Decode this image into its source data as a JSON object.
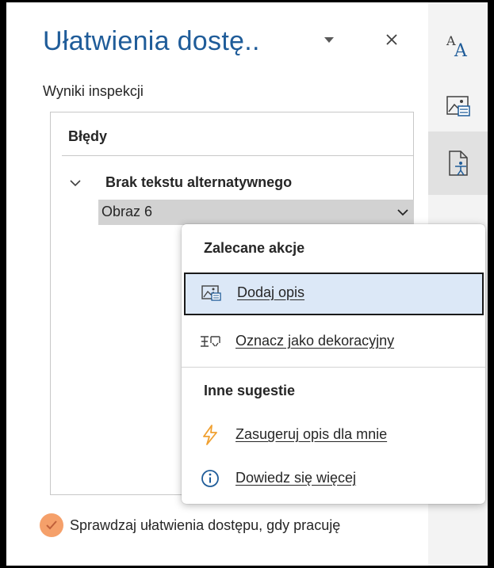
{
  "pane": {
    "title": "Ułatwienia dostę..",
    "results_label": "Wyniki inspekcji",
    "errors_header": "Błędy",
    "issue_label": "Brak tekstu alternatywnego",
    "issue_item": "Obraz 6",
    "check_label": "Sprawdzaj ułatwienia dostępu, gdy pracuję"
  },
  "menu": {
    "group1_title": "Zalecane akcje",
    "items_recommended": [
      {
        "label": "Dodaj opis",
        "icon": "image-alt-text-icon"
      },
      {
        "label": "Oznacz jako dekoracyjny",
        "icon": "decorative-mark-icon"
      }
    ],
    "group2_title": "Inne sugestie",
    "items_other": [
      {
        "label": "Zasugeruj opis dla mnie",
        "icon": "lightning-icon"
      },
      {
        "label": "Dowiedz się więcej",
        "icon": "info-icon"
      }
    ]
  },
  "rail": {
    "buttons": [
      "font-size-icon",
      "image-alt-icon",
      "accessibility-icon"
    ]
  },
  "colors": {
    "title": "#1f5c99",
    "selected_bg": "#dce8f7",
    "check_accent": "#f5a06a",
    "lightning": "#f0a030",
    "info": "#1f5c99"
  }
}
